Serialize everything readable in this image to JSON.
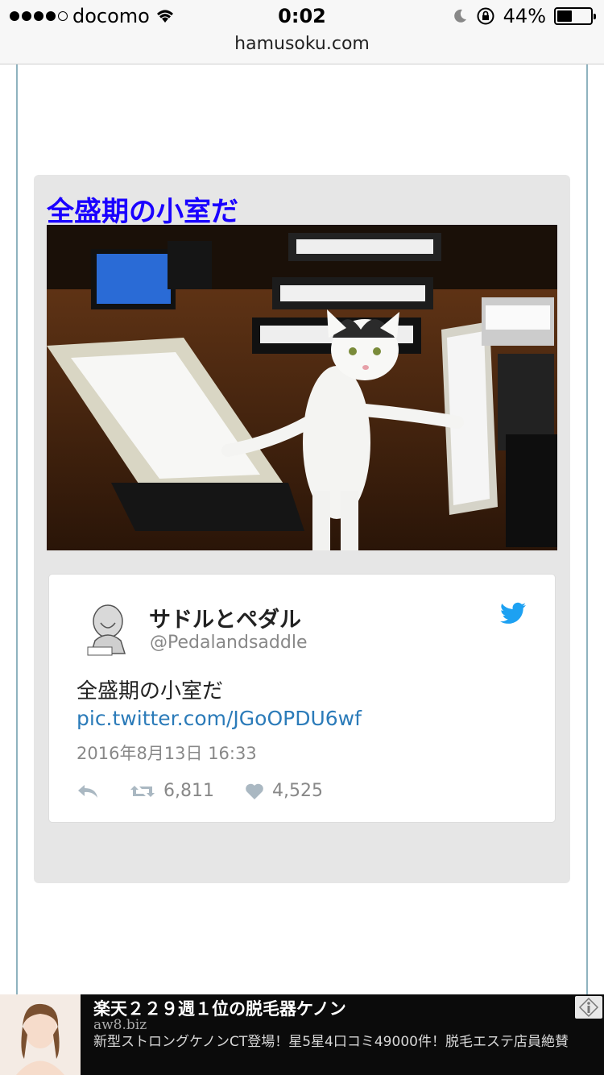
{
  "status_bar": {
    "carrier": "docomo",
    "time": "0:02",
    "battery_percent": "44%",
    "battery_level": 0.44,
    "signal_bars": 4
  },
  "browser": {
    "url": "hamusoku.com"
  },
  "post": {
    "title": "全盛期の小室だ",
    "image_icon": "photo-cat-keyboards"
  },
  "tweet": {
    "name": "サドルとペダル",
    "handle": "@Pedalandsaddle",
    "text": "全盛期の小室だ",
    "link": "pic.twitter.com/JGoOPDU6wf",
    "date": "2016年8月13日 16:33",
    "retweets": "6,811",
    "likes": "4,525",
    "brand_color": "#1da1f2"
  },
  "ad": {
    "title": "楽天２２９週１位の脱毛器ケノン",
    "domain": "aw8.biz",
    "description": "新型ストロングケノンCT登場！星5星4口コミ49000件！脱毛エステ店員絶賛"
  }
}
